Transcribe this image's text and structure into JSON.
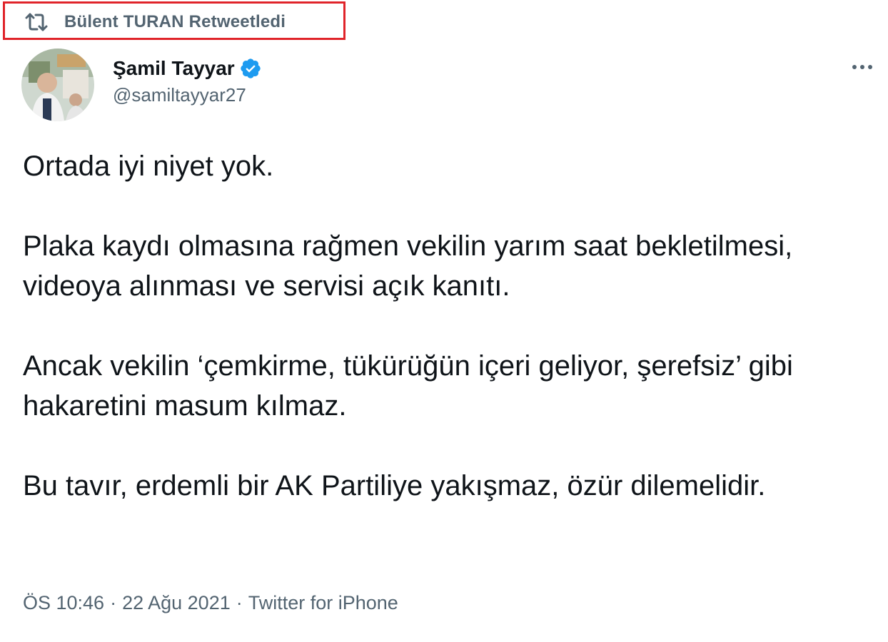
{
  "retweet": {
    "text": "Bülent TURAN Retweetledi",
    "icon": "retweet-icon",
    "highlight_color": "#e0242a"
  },
  "author": {
    "name": "Şamil Tayyar",
    "handle": "@samiltayyar27",
    "verified": true,
    "verified_color": "#1d9bf0"
  },
  "tweet": {
    "paragraphs": [
      "Ortada iyi niyet yok.",
      "Plaka kaydı olmasına rağmen vekilin yarım saat bekletilmesi, videoya alınması ve servisi açık kanıtı.",
      "Ancak vekilin ‘çemkirme, tükürüğün içeri geliyor, şerefsiz’ gibi hakaretini masum kılmaz.",
      "Bu tavır, erdemli bir AK Partiliye yakışmaz, özür dilemelidir."
    ]
  },
  "meta": {
    "time": "ÖS 10:46",
    "date": "22 Ağu 2021",
    "separator": "·",
    "source": "Twitter for iPhone"
  },
  "colors": {
    "text_primary": "#0f1419",
    "text_secondary": "#536471"
  }
}
